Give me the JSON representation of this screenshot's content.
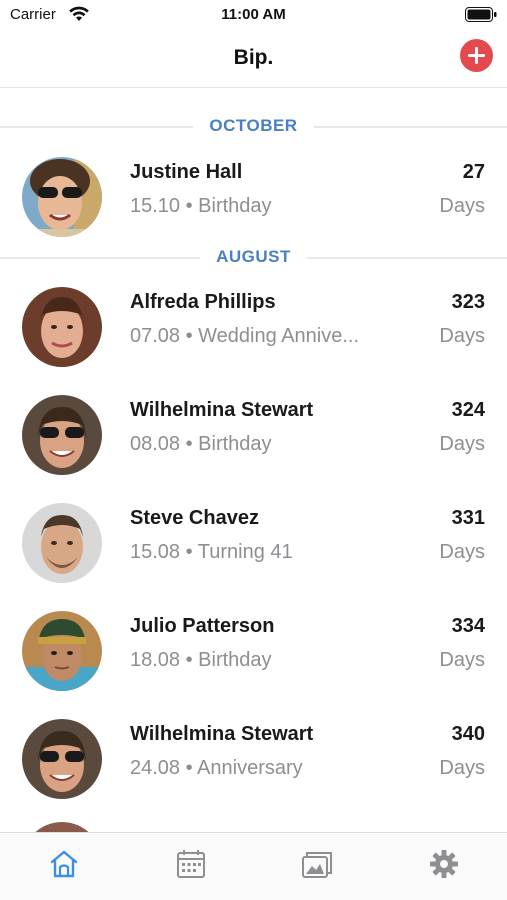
{
  "status_bar": {
    "carrier": "Carrier",
    "time": "11:00 AM",
    "icons": [
      "wifi-icon",
      "battery-icon"
    ]
  },
  "nav": {
    "title": "Bip.",
    "add_icon": "plus-icon",
    "add_color": "#e5484d"
  },
  "sections": [
    {
      "label": "OCTOBER",
      "rows": [
        {
          "name": "Justine Hall",
          "sub": "15.10 • Birthday",
          "days": "27",
          "days_label": "Days"
        }
      ]
    },
    {
      "label": "AUGUST",
      "rows": [
        {
          "name": "Alfreda Phillips",
          "sub": "07.08 • Wedding Annive...",
          "days": "323",
          "days_label": "Days"
        },
        {
          "name": "Wilhelmina Stewart",
          "sub": "08.08 • Birthday",
          "days": "324",
          "days_label": "Days"
        },
        {
          "name": "Steve Chavez",
          "sub": "15.08 • Turning 41",
          "days": "331",
          "days_label": "Days"
        },
        {
          "name": "Julio Patterson",
          "sub": "18.08 • Birthday",
          "days": "334",
          "days_label": "Days"
        },
        {
          "name": "Wilhelmina Stewart",
          "sub": "24.08 • Anniversary",
          "days": "340",
          "days_label": "Days"
        }
      ]
    }
  ],
  "tabs": [
    {
      "icon": "home-icon",
      "active": true
    },
    {
      "icon": "calendar-icon",
      "active": false
    },
    {
      "icon": "cards-icon",
      "active": false
    },
    {
      "icon": "gear-icon",
      "active": false
    }
  ],
  "colors": {
    "accent": "#4a7fc1",
    "active_tab": "#3a8ee6",
    "inactive_tab": "#8e8e93",
    "secondary_text": "#8e8e93"
  }
}
